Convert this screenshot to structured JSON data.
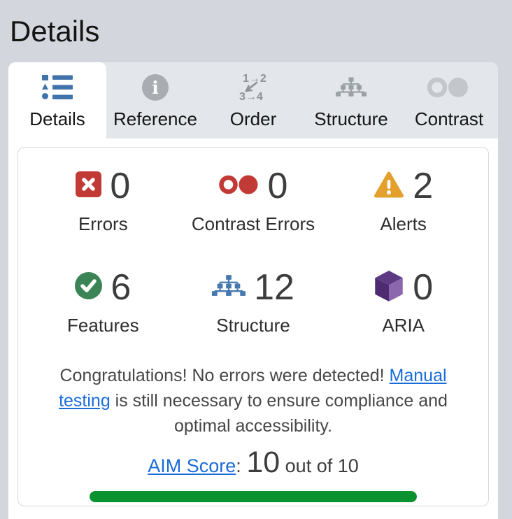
{
  "header": {
    "title": "Details"
  },
  "tabs": [
    {
      "label": "Details",
      "icon": "list-icon",
      "active": true
    },
    {
      "label": "Reference",
      "icon": "info-icon",
      "active": false
    },
    {
      "label": "Order",
      "icon": "order-icon",
      "active": false
    },
    {
      "label": "Structure",
      "icon": "sitemap-icon",
      "active": false
    },
    {
      "label": "Contrast",
      "icon": "contrast-icon",
      "active": false
    }
  ],
  "summary": {
    "stats": [
      {
        "label": "Errors",
        "value": "0",
        "icon": "error-icon",
        "color": "#c23a35"
      },
      {
        "label": "Contrast Errors",
        "value": "0",
        "icon": "contrast-error-icon",
        "color": "#c23a35"
      },
      {
        "label": "Alerts",
        "value": "2",
        "icon": "alert-icon",
        "color": "#e3a02d"
      },
      {
        "label": "Features",
        "value": "6",
        "icon": "feature-icon",
        "color": "#3a8456"
      },
      {
        "label": "Structure",
        "value": "12",
        "icon": "structure-icon",
        "color": "#4478ae"
      },
      {
        "label": "ARIA",
        "value": "0",
        "icon": "aria-icon",
        "color": "#4e2b71"
      }
    ],
    "message": {
      "before_link": "Congratulations! No errors were detected! ",
      "link": "Manual testing",
      "after_link": " is still necessary to ensure compliance and optimal accessibility."
    },
    "aim": {
      "link": "AIM Score",
      "separator": ": ",
      "score": "10",
      "suffix": " out of 10",
      "bar_percent": 100
    }
  },
  "colors": {
    "page_bg": "#d3d6dc",
    "tabbar_bg": "#e3e6ea",
    "card_border": "#d6d9dc",
    "error_red": "#c23a35",
    "alert_orange": "#e3a02d",
    "feature_green": "#3a8456",
    "structure_blue": "#4478ae",
    "aria_purple": "#4e2b71",
    "link_blue": "#1a6cd9",
    "bar_green": "#0a9130",
    "inactive_icon_gray": "#a9adb2"
  }
}
